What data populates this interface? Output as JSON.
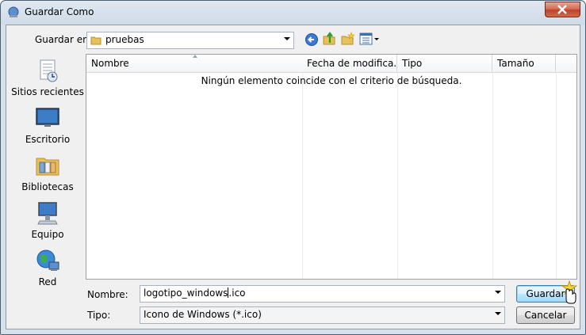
{
  "window": {
    "title": "Guardar Como"
  },
  "toolbar": {
    "save_in_label": "Guardar en:",
    "save_in_value": "pruebas",
    "icons": [
      "back-icon",
      "up-folder-icon",
      "new-folder-icon",
      "view-menu-icon"
    ]
  },
  "places": [
    {
      "label": "Sitios recientes",
      "icon": "recent-places-icon"
    },
    {
      "label": "Escritorio",
      "icon": "desktop-icon"
    },
    {
      "label": "Bibliotecas",
      "icon": "libraries-icon"
    },
    {
      "label": "Equipo",
      "icon": "computer-icon"
    },
    {
      "label": "Red",
      "icon": "network-icon"
    }
  ],
  "list": {
    "columns": [
      "Nombre",
      "Fecha de modifica...",
      "Tipo",
      "Tamaño"
    ],
    "empty_message": "Ningún elemento coincide con el criterio de búsqueda."
  },
  "form": {
    "name_label": "Nombre:",
    "name_value_before_caret": "logotipo_windows",
    "name_value_after_caret": ".ico",
    "type_label": "Tipo:",
    "type_value": "Icono de Windows (*.ico)"
  },
  "buttons": {
    "save": "Guardar",
    "cancel": "Cancelar"
  },
  "colors": {
    "accent": "#3c7fb1",
    "close": "#c2412a",
    "frame": "#cfdbe8"
  }
}
